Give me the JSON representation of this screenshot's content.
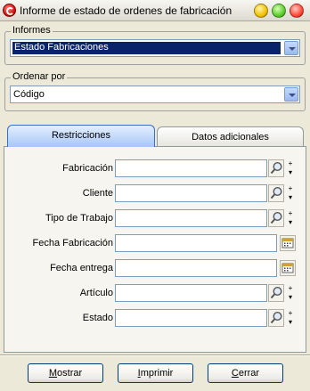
{
  "window": {
    "title": "Informe de estado de ordenes de fabricación"
  },
  "informes": {
    "label": "Informes",
    "selected": "Estado Fabricaciones"
  },
  "ordenar": {
    "label": "Ordenar por",
    "selected": "Código"
  },
  "tabs": {
    "active": "Restricciones",
    "inactive": "Datos adicionales"
  },
  "fields": [
    {
      "label": "Fabricación",
      "kind": "search"
    },
    {
      "label": "Cliente",
      "kind": "search"
    },
    {
      "label": "Tipo de Trabajo",
      "kind": "search"
    },
    {
      "label": "Fecha Fabricación",
      "kind": "date"
    },
    {
      "label": "Fecha entrega",
      "kind": "date"
    },
    {
      "label": "Artículo",
      "kind": "search"
    },
    {
      "label": "Estado",
      "kind": "search"
    }
  ],
  "buttons": {
    "mostrar": {
      "accel": "M",
      "rest": "ostrar"
    },
    "imprimir": {
      "accel": "I",
      "rest": "mprimir"
    },
    "cerrar": {
      "accel": "C",
      "rest": "errar"
    }
  },
  "colors": {
    "selection": "#0a246a",
    "tab_active": "#a7c6f5",
    "button_border": "#003c74"
  }
}
